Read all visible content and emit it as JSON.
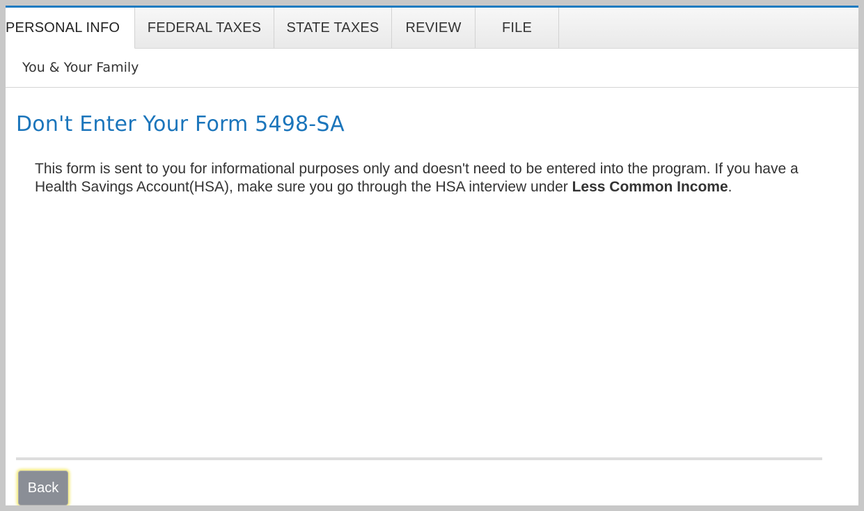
{
  "tabs": [
    {
      "label": "PERSONAL INFO",
      "active": true
    },
    {
      "label": "FEDERAL TAXES",
      "active": false
    },
    {
      "label": "STATE TAXES",
      "active": false
    },
    {
      "label": "REVIEW",
      "active": false
    },
    {
      "label": "FILE",
      "active": false
    }
  ],
  "subheader": {
    "label": "You & Your Family"
  },
  "main": {
    "title": "Don't Enter Your Form 5498-SA",
    "message_part1": "This form is sent to you for informational purposes only and doesn't need to be entered into the program. If you have a Health Savings Account(HSA), make sure you go through the HSA interview under ",
    "message_bold": "Less Common Income",
    "message_part2": "."
  },
  "footer": {
    "back_label": "Back"
  },
  "colors": {
    "accent": "#1b75bb",
    "button_bg": "#8a8e96",
    "focus_glow": "#f4ea6a"
  }
}
